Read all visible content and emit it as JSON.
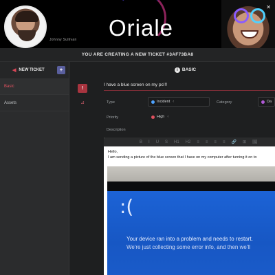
{
  "header": {
    "username": "Johnny Sullivan",
    "logo": "Oriale",
    "icons": [
      "close-icon",
      "minimize-icon"
    ]
  },
  "banner": {
    "text": "YOU ARE CREATING A NEW TICKET #3AF73BA8"
  },
  "sidebar": {
    "title": "NEW TICKET",
    "add_label": "+",
    "items": [
      {
        "label": "Basic",
        "active": true
      },
      {
        "label": "Assets",
        "active": false
      }
    ]
  },
  "rail": {
    "buttons": [
      "alert-icon",
      "hierarchy-icon"
    ]
  },
  "main": {
    "section_title": "BASIC",
    "subject": "I have a blue screen on my pc!!!",
    "type_label": "Type",
    "type_value": "Incident",
    "category_label": "Category",
    "category_value": "Da",
    "priority_label": "Priority",
    "priority_value": "High",
    "description_label": "Description",
    "toolbar": [
      "B",
      "I",
      "U",
      "S",
      "H1",
      "H2",
      "≡",
      "≡",
      "≡",
      "≡",
      "🔗",
      "⊞",
      "🖼"
    ],
    "description_line1": "Hello,",
    "description_line2": "I am sending a picture of the blue screen that I have on my computer after turning it on to",
    "bsod_face": ":(",
    "bsod_msg1": "Your device ran into a problem and needs to restart.",
    "bsod_msg2": "We're just collecting some error info, and then we'll"
  },
  "colors": {
    "accent": "#e0515f",
    "rail_alert": "#a8343f",
    "bsod_blue": "#1c63d6",
    "incident_dot": "#4fa3ff",
    "high_dot": "#e0515f",
    "category_dot": "#b05ad6"
  }
}
